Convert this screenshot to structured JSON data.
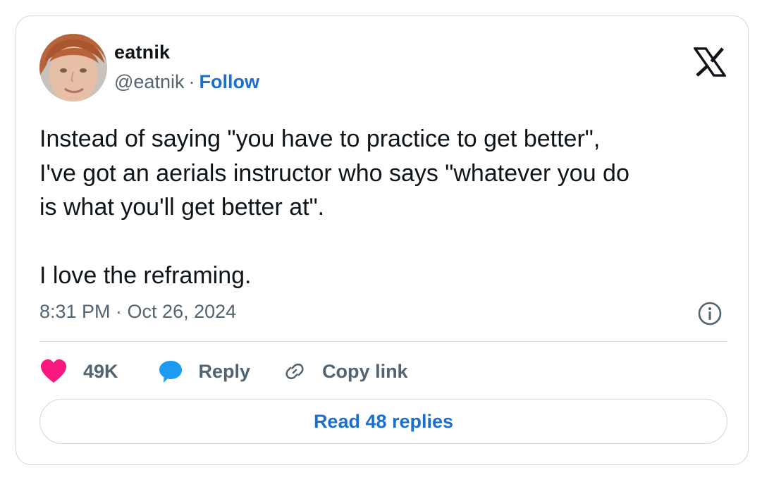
{
  "author": {
    "display_name": "eatnik",
    "handle": "@eatnik",
    "separator": "·",
    "follow_label": "Follow"
  },
  "tweet": {
    "lines": [
      "Instead of saying \"you have to practice to get better\",",
      "I've got an aerials instructor who says \"whatever you do",
      "is what you'll get better at\"."
    ],
    "closing": "I love the reframing.",
    "timestamp": "8:31 PM · Oct 26, 2024"
  },
  "actions": {
    "likes": "49K",
    "reply_label": "Reply",
    "copy_link_label": "Copy link"
  },
  "replies_button": "Read 48 replies",
  "icons": {
    "brand": "x-logo-icon",
    "info": "info-icon",
    "like": "heart-icon",
    "reply": "speech-bubble-icon",
    "copy": "link-icon"
  },
  "colors": {
    "link_blue": "#1d6fcf",
    "heart_pink": "#f91880",
    "reply_blue": "#1d9bf0",
    "secondary_text": "#536471",
    "border": "#cfd9de"
  }
}
